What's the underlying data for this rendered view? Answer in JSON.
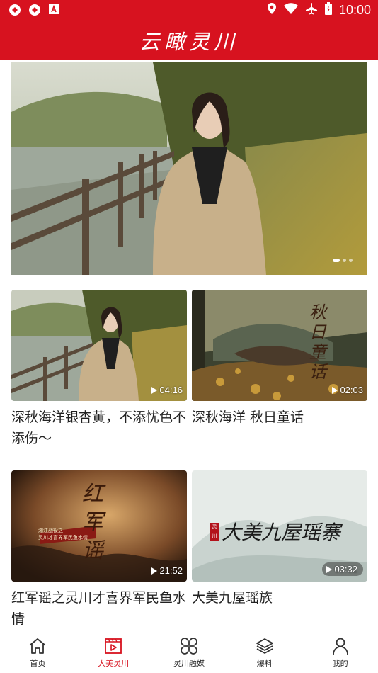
{
  "status_bar": {
    "time": "10:00",
    "left_icons": [
      "app-icon-1",
      "app-icon-2",
      "app-icon-3"
    ],
    "right_icons": [
      "location-icon",
      "wifi-icon",
      "airplane-icon",
      "battery-icon"
    ]
  },
  "header": {
    "title": "云瞰灵川"
  },
  "hero": {
    "slides": 3,
    "active_slide": 1
  },
  "cards": [
    {
      "title": "深秋海洋银杏黄，不添忧色不添伤～",
      "duration": "04:16"
    },
    {
      "title": "深秋海洋 秋日童话",
      "duration": "02:03",
      "thumb_text": "秋日童话"
    },
    {
      "title": "红军谣之灵川才喜界军民鱼水情",
      "duration": "21:52",
      "thumb_text": "红军谣",
      "thumb_subtext": "湘江战役之\n灵川才喜界军民鱼水情"
    },
    {
      "title": "大美九屋瑶族",
      "duration": "03:32",
      "thumb_text": "大美九屋瑶寨",
      "thumb_seal": "灵川"
    }
  ],
  "bottom_nav": [
    {
      "label": "首页",
      "icon": "home-icon"
    },
    {
      "label": "大美灵川",
      "icon": "video-icon",
      "active": true
    },
    {
      "label": "灵川融媒",
      "icon": "clover-icon"
    },
    {
      "label": "爆料",
      "icon": "layers-icon"
    },
    {
      "label": "我的",
      "icon": "user-icon"
    }
  ],
  "colors": {
    "brand": "#d7121f",
    "text": "#222222"
  }
}
